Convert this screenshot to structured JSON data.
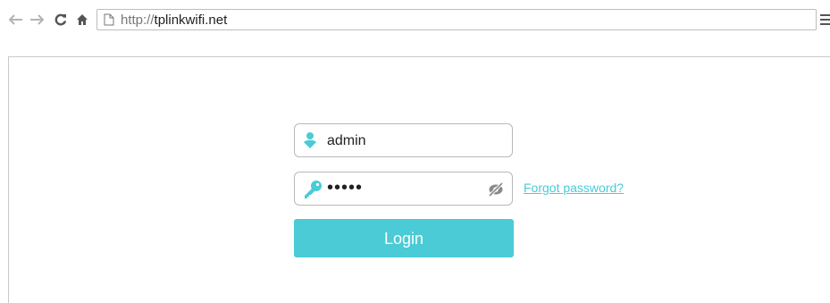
{
  "browser": {
    "url_scheme": "http://",
    "url_host": "tplinkwifi.net",
    "icons": {
      "back": "arrow-left-icon",
      "forward": "arrow-right-icon",
      "reload": "reload-icon",
      "home": "home-icon",
      "page": "page-icon",
      "menu": "hamburger-menu-icon"
    }
  },
  "login_form": {
    "username_value": "admin",
    "password_value": "•••••",
    "forgot_password_label": "Forgot password?",
    "login_label": "Login",
    "icons": {
      "username": "user-icon",
      "password": "key-icon",
      "toggle_visibility": "eye-hidden-icon"
    }
  },
  "colors": {
    "accent": "#4acbd6",
    "button_text": "#ffffff"
  }
}
